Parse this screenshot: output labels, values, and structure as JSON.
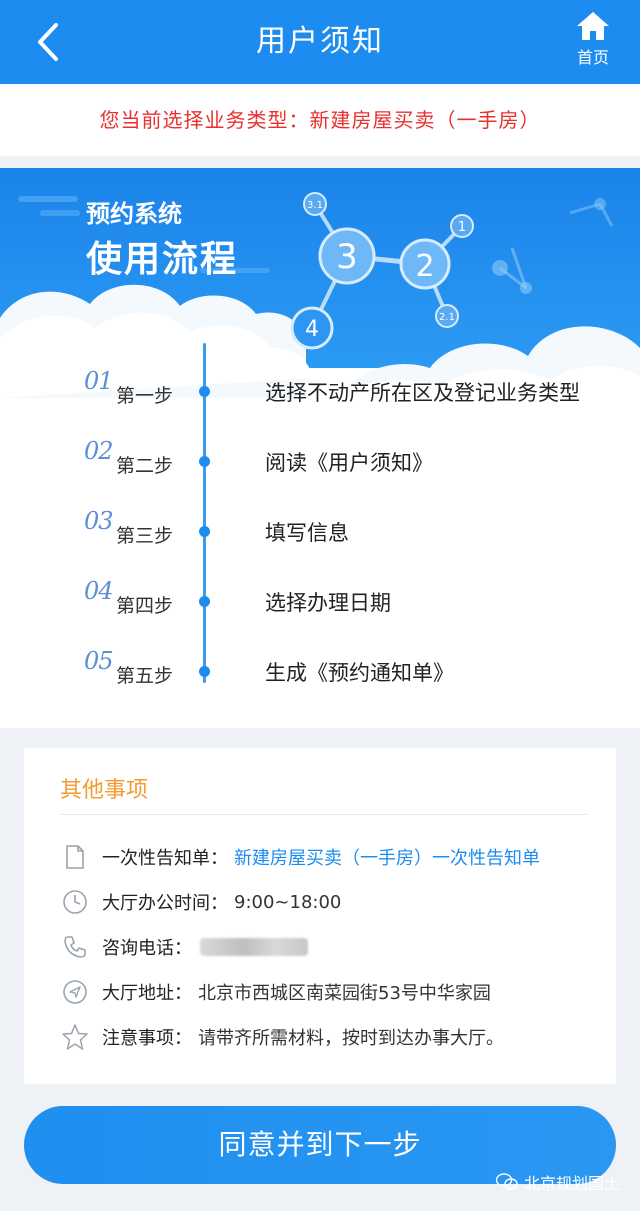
{
  "header": {
    "title": "用户须知",
    "home_label": "首页"
  },
  "business": {
    "text": "您当前选择业务类型：新建房屋买卖（一手房）"
  },
  "flow": {
    "title_small": "预约系统",
    "title_large": "使用流程",
    "badges": [
      "3",
      "2",
      "1",
      "4",
      "3.1",
      "2.1"
    ],
    "steps": [
      {
        "num": "01",
        "name": "第一步",
        "desc": "选择不动产所在区及登记业务类型"
      },
      {
        "num": "02",
        "name": "第二步",
        "desc": "阅读《用户须知》"
      },
      {
        "num": "03",
        "name": "第三步",
        "desc": "填写信息"
      },
      {
        "num": "04",
        "name": "第四步",
        "desc": "选择办理日期"
      },
      {
        "num": "05",
        "name": "第五步",
        "desc": "生成《预约通知单》"
      }
    ]
  },
  "other": {
    "heading": "其他事项",
    "items": [
      {
        "icon": "document-icon",
        "key": "一次性告知单：",
        "value": "新建房屋买卖（一手房）一次性告知单"
      },
      {
        "icon": "clock-icon",
        "key": "大厅办公时间：",
        "value": "9:00~18:00"
      },
      {
        "icon": "phone-icon",
        "key": "咨询电话：",
        "value": ""
      },
      {
        "icon": "location-icon",
        "key": "大厅地址：",
        "value": "北京市西城区南菜园街53号中华家园"
      },
      {
        "icon": "star-icon",
        "key": "注意事项：",
        "value": "请带齐所需材料，按时到达办事大厅。"
      }
    ]
  },
  "next_button": "同意并到下一步",
  "watermark": "北京规划国土",
  "colors": {
    "primary": "#1d8cf0",
    "alert": "#e8312f",
    "heading": "#f39b2f"
  }
}
